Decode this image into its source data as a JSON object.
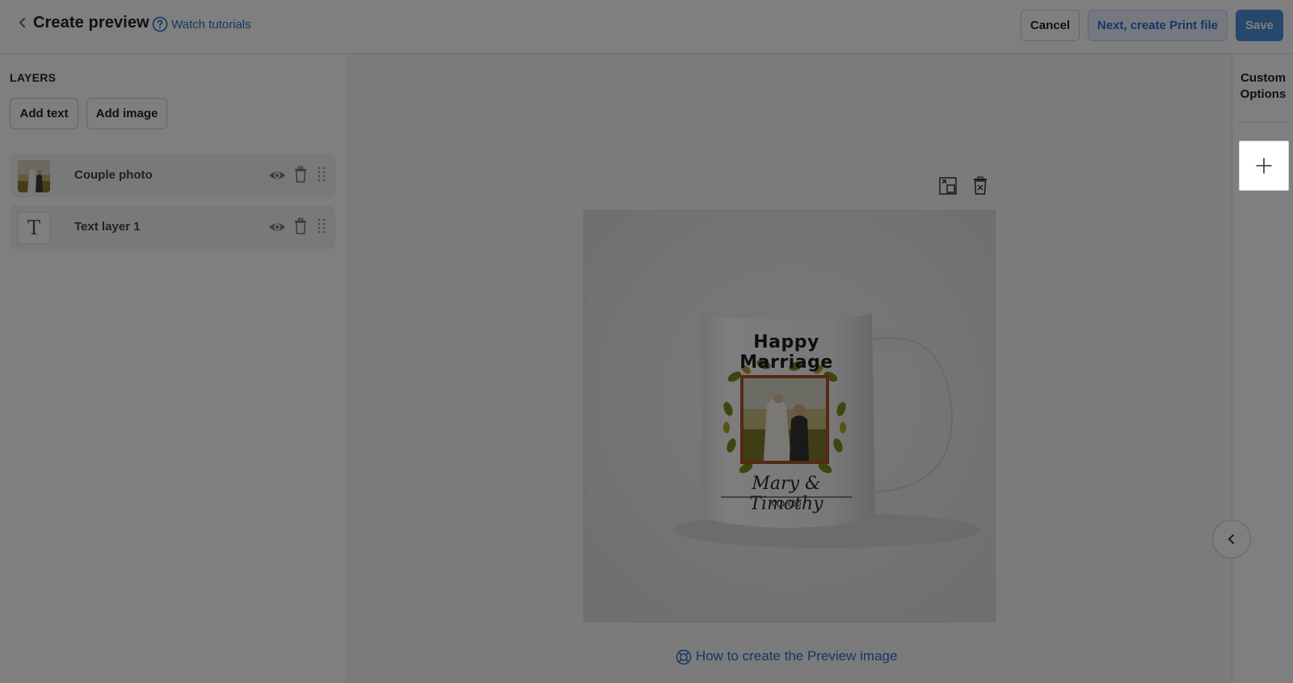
{
  "header": {
    "title": "Create preview",
    "tutorials_label": "Watch tutorials",
    "cancel_label": "Cancel",
    "next_label": "Next, create Print file",
    "save_label": "Save"
  },
  "layers": {
    "title": "LAYERS",
    "add_text_label": "Add text",
    "add_image_label": "Add image",
    "items": [
      {
        "name": "Couple photo",
        "type": "image"
      },
      {
        "name": "Text layer 1",
        "type": "text"
      }
    ]
  },
  "canvas": {
    "mug_title": "Happy Marriage",
    "mug_names": "Mary & Timothy",
    "howto_label": "How to create the Preview image"
  },
  "right_panel": {
    "title_line1": "Custom",
    "title_line2": "Options"
  },
  "colors": {
    "accent": "#2c6ecb",
    "save_bg": "#4a90d9",
    "overlay": "rgba(0,0,0,0.5)"
  }
}
